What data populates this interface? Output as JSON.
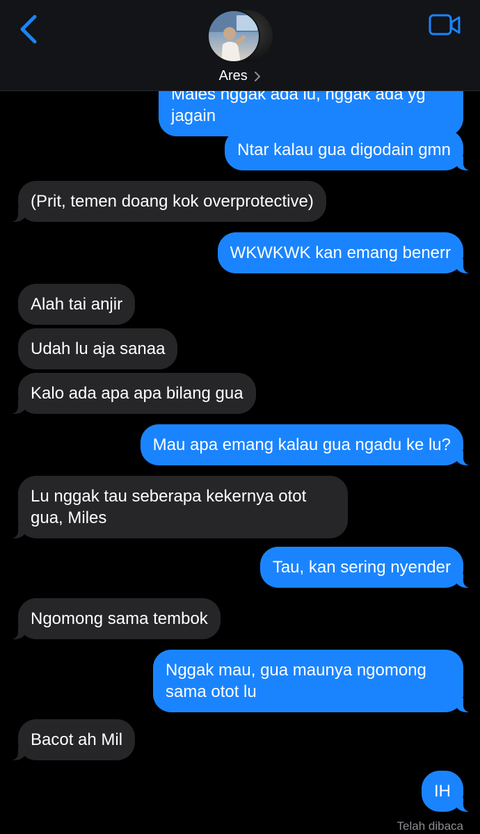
{
  "header": {
    "contact_name": "Ares",
    "back_icon": "chevron-left-icon",
    "video_icon": "video-camera-icon",
    "accent_color": "#1a84ff"
  },
  "messages": [
    {
      "from": "me",
      "text": "Males nggak ada lu, nggak ada yg jagain"
    },
    {
      "from": "me",
      "text": "Ntar kalau gua digodain gmn"
    },
    {
      "from": "them",
      "text": "(Prit, temen doang kok overprotective)"
    },
    {
      "from": "me",
      "text": "WKWKWK kan emang benerr"
    },
    {
      "from": "them",
      "text": "Alah tai anjir"
    },
    {
      "from": "them",
      "text": "Udah lu aja sanaa"
    },
    {
      "from": "them",
      "text": "Kalo ada apa apa bilang gua"
    },
    {
      "from": "me",
      "text": "Mau apa emang kalau gua ngadu ke lu?"
    },
    {
      "from": "them",
      "text": "Lu nggak tau seberapa kekernya otot gua, Miles"
    },
    {
      "from": "me",
      "text": "Tau, kan sering nyender"
    },
    {
      "from": "them",
      "text": "Ngomong sama tembok"
    },
    {
      "from": "me",
      "text": "Nggak mau, gua maunya ngomong sama otot lu"
    },
    {
      "from": "them",
      "text": "Bacot ah Mil"
    },
    {
      "from": "me",
      "text": "IH"
    }
  ],
  "status": {
    "read_receipt": "Telah dibaca"
  },
  "colors": {
    "incoming_bubble": "#262628",
    "outgoing_bubble": "#1a84ff",
    "background": "#000000"
  }
}
